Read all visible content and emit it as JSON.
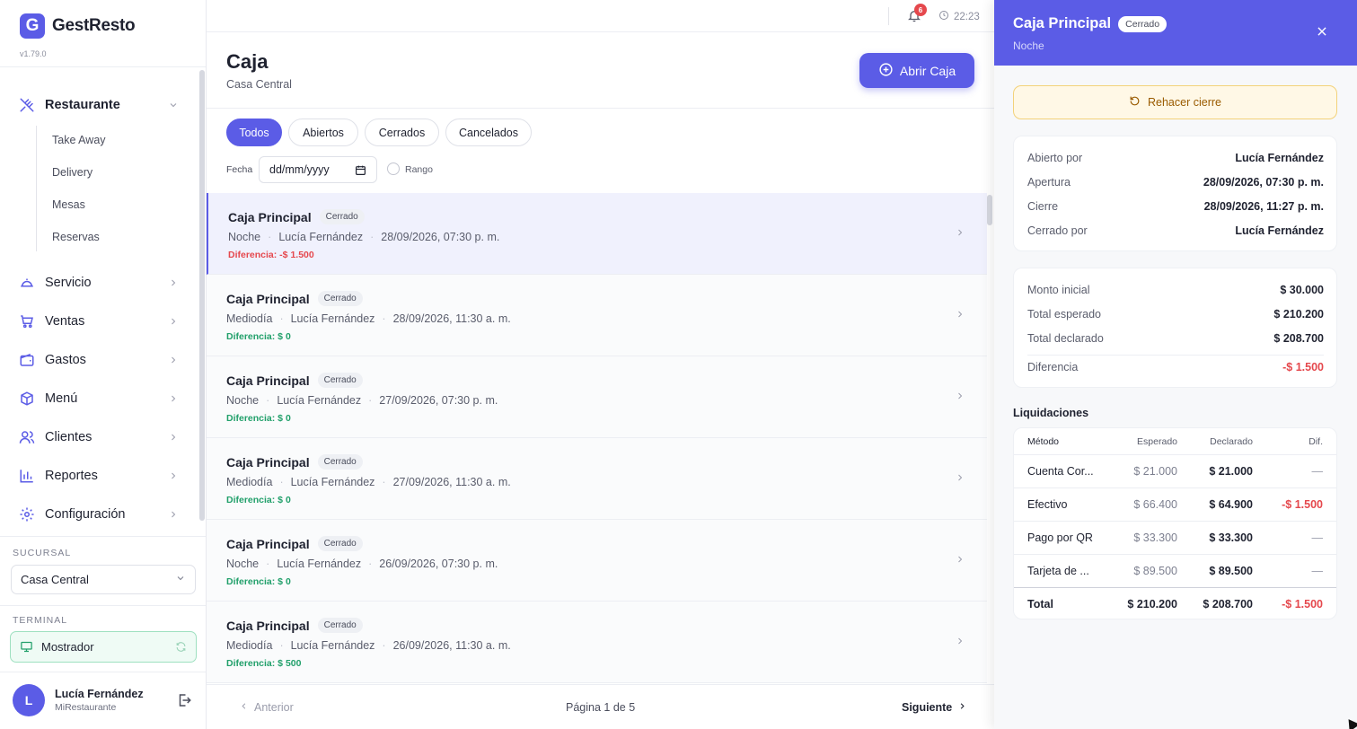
{
  "app": {
    "name": "GestResto",
    "logo_letter": "G",
    "version": "v1.79.0",
    "brand_color": "#5b5ce6"
  },
  "sidebar": {
    "sections": [
      {
        "label": "Restaurante",
        "icon": "utensils-icon",
        "expanded": true
      },
      {
        "label": "Servicio",
        "icon": "cloche-icon"
      },
      {
        "label": "Ventas",
        "icon": "cart-icon"
      },
      {
        "label": "Gastos",
        "icon": "wallet-icon"
      },
      {
        "label": "Menú",
        "icon": "box-icon"
      },
      {
        "label": "Clientes",
        "icon": "users-icon"
      },
      {
        "label": "Reportes",
        "icon": "bar-chart-icon"
      },
      {
        "label": "Configuración",
        "icon": "gear-icon"
      }
    ],
    "restaurante_items": [
      "Take Away",
      "Delivery",
      "Mesas",
      "Reservas"
    ],
    "branch_label": "SUCURSAL",
    "branch_value": "Casa Central",
    "terminal_label": "TERMINAL",
    "terminal_value": "Mostrador",
    "user": {
      "initial": "L",
      "name": "Lucía Fernández",
      "org": "MiRestaurante"
    }
  },
  "topbar": {
    "notifications": "6",
    "time": "22:23"
  },
  "main": {
    "title": "Caja",
    "subtitle": "Casa Central",
    "open_button": "Abrir Caja",
    "filters": [
      "Todos",
      "Abiertos",
      "Cerrados",
      "Cancelados"
    ],
    "active_filter": "Todos",
    "date_label": "Fecha",
    "date_placeholder": "dd/mm/yyyy",
    "range_label": "Rango"
  },
  "list": [
    {
      "name": "Caja Principal",
      "status": "Cerrado",
      "shift": "Noche",
      "user": "Lucía Fernández",
      "datetime": "28/09/2026, 07:30 p. m.",
      "diff": "Diferencia: -$ 1.500",
      "diff_sign": "neg",
      "selected": true
    },
    {
      "name": "Caja Principal",
      "status": "Cerrado",
      "shift": "Mediodía",
      "user": "Lucía Fernández",
      "datetime": "28/09/2026, 11:30 a. m.",
      "diff": "Diferencia: $ 0",
      "diff_sign": "pos"
    },
    {
      "name": "Caja Principal",
      "status": "Cerrado",
      "shift": "Noche",
      "user": "Lucía Fernández",
      "datetime": "27/09/2026, 07:30 p. m.",
      "diff": "Diferencia: $ 0",
      "diff_sign": "pos"
    },
    {
      "name": "Caja Principal",
      "status": "Cerrado",
      "shift": "Mediodía",
      "user": "Lucía Fernández",
      "datetime": "27/09/2026, 11:30 a. m.",
      "diff": "Diferencia: $ 0",
      "diff_sign": "pos"
    },
    {
      "name": "Caja Principal",
      "status": "Cerrado",
      "shift": "Noche",
      "user": "Lucía Fernández",
      "datetime": "26/09/2026, 07:30 p. m.",
      "diff": "Diferencia: $ 0",
      "diff_sign": "pos"
    },
    {
      "name": "Caja Principal",
      "status": "Cerrado",
      "shift": "Mediodía",
      "user": "Lucía Fernández",
      "datetime": "26/09/2026, 11:30 a. m.",
      "diff": "Diferencia: $ 500",
      "diff_sign": "pos"
    }
  ],
  "pagination": {
    "prev": "Anterior",
    "info": "Página 1 de 5",
    "next": "Siguiente"
  },
  "panel": {
    "title": "Caja Principal",
    "status": "Cerrado",
    "subtitle": "Noche",
    "redo_button": "Rehacer cierre",
    "details": [
      {
        "k": "Abierto por",
        "v": "Lucía Fernández"
      },
      {
        "k": "Apertura",
        "v": "28/09/2026, 07:30 p. m."
      },
      {
        "k": "Cierre",
        "v": "28/09/2026, 11:27 p. m."
      },
      {
        "k": "Cerrado por",
        "v": "Lucía Fernández"
      }
    ],
    "totals": [
      {
        "k": "Monto inicial",
        "v": "$ 30.000"
      },
      {
        "k": "Total esperado",
        "v": "$ 210.200"
      },
      {
        "k": "Total declarado",
        "v": "$ 208.700"
      }
    ],
    "difference": {
      "k": "Diferencia",
      "v": "-$ 1.500"
    },
    "liquidaciones": {
      "title": "Liquidaciones",
      "headers": [
        "Método",
        "Esperado",
        "Declarado",
        "Dif."
      ],
      "rows": [
        {
          "method": "Cuenta Cor...",
          "expected": "$ 21.000",
          "declared": "$ 21.000",
          "diff": "—",
          "neg": false
        },
        {
          "method": "Efectivo",
          "expected": "$ 66.400",
          "declared": "$ 64.900",
          "diff": "-$ 1.500",
          "neg": true
        },
        {
          "method": "Pago por QR",
          "expected": "$ 33.300",
          "declared": "$ 33.300",
          "diff": "—",
          "neg": false
        },
        {
          "method": "Tarjeta de ...",
          "expected": "$ 89.500",
          "declared": "$ 89.500",
          "diff": "—",
          "neg": false
        }
      ],
      "total": {
        "method": "Total",
        "expected": "$ 210.200",
        "declared": "$ 208.700",
        "diff": "-$ 1.500"
      }
    }
  }
}
